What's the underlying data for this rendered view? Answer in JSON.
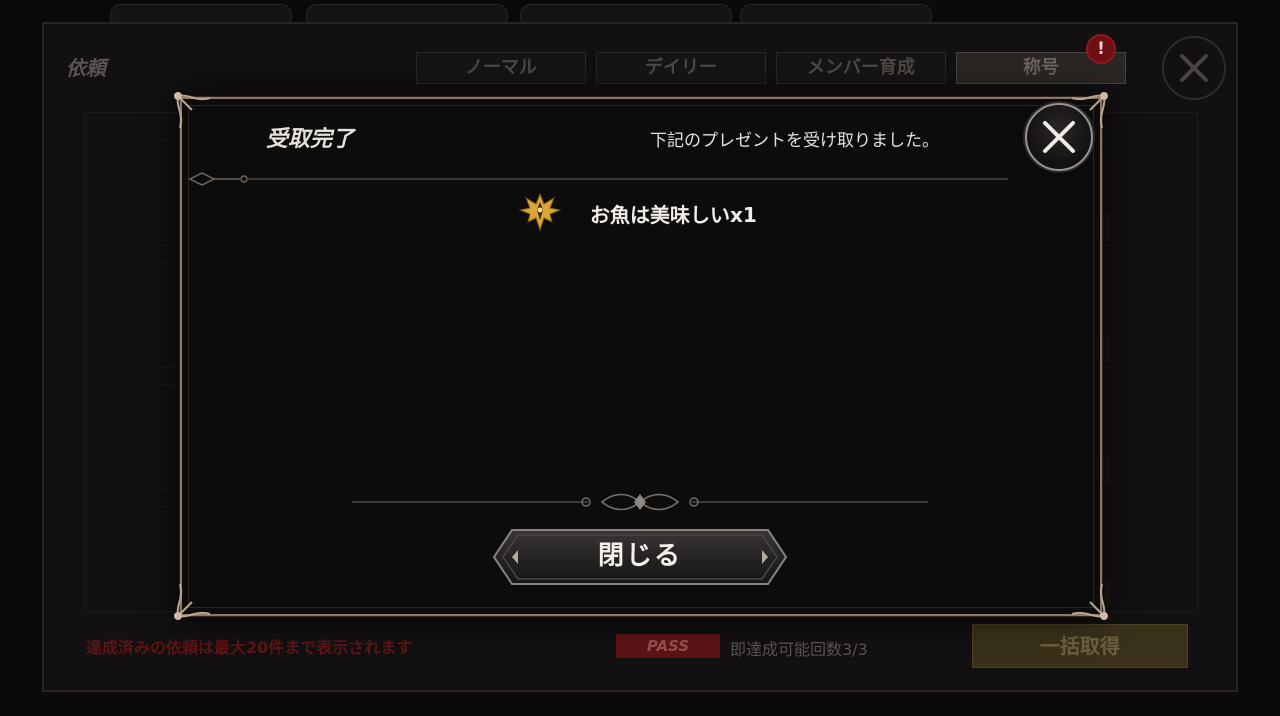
{
  "background": {
    "title": "依頼",
    "tabs": [
      {
        "label": "ノーマル",
        "active": false
      },
      {
        "label": "デイリー",
        "active": false
      },
      {
        "label": "メンバー育成",
        "active": false
      },
      {
        "label": "称号",
        "active": true
      }
    ],
    "notification_badge": "!",
    "close_icon": "close-icon",
    "footer_note": "達成済みの依頼は最大20件まで表示されます",
    "pass_label": "PASS",
    "instant_complete": "即達成可能回数3/3",
    "bulk_receive_label": "一括取得"
  },
  "modal": {
    "title": "受取完了",
    "message": "下記のプレゼントを受け取りました。",
    "reward": {
      "icon": "title-emblem-icon",
      "text": "お魚は美味しいx1"
    },
    "close_button_label": "閉じる",
    "close_icon": "close-icon"
  },
  "colors": {
    "frame_gold": "#8a7866",
    "modal_bg": "#0d0c0c",
    "reward_gold": "#d9a63a",
    "badge_red": "#8d1a20"
  }
}
